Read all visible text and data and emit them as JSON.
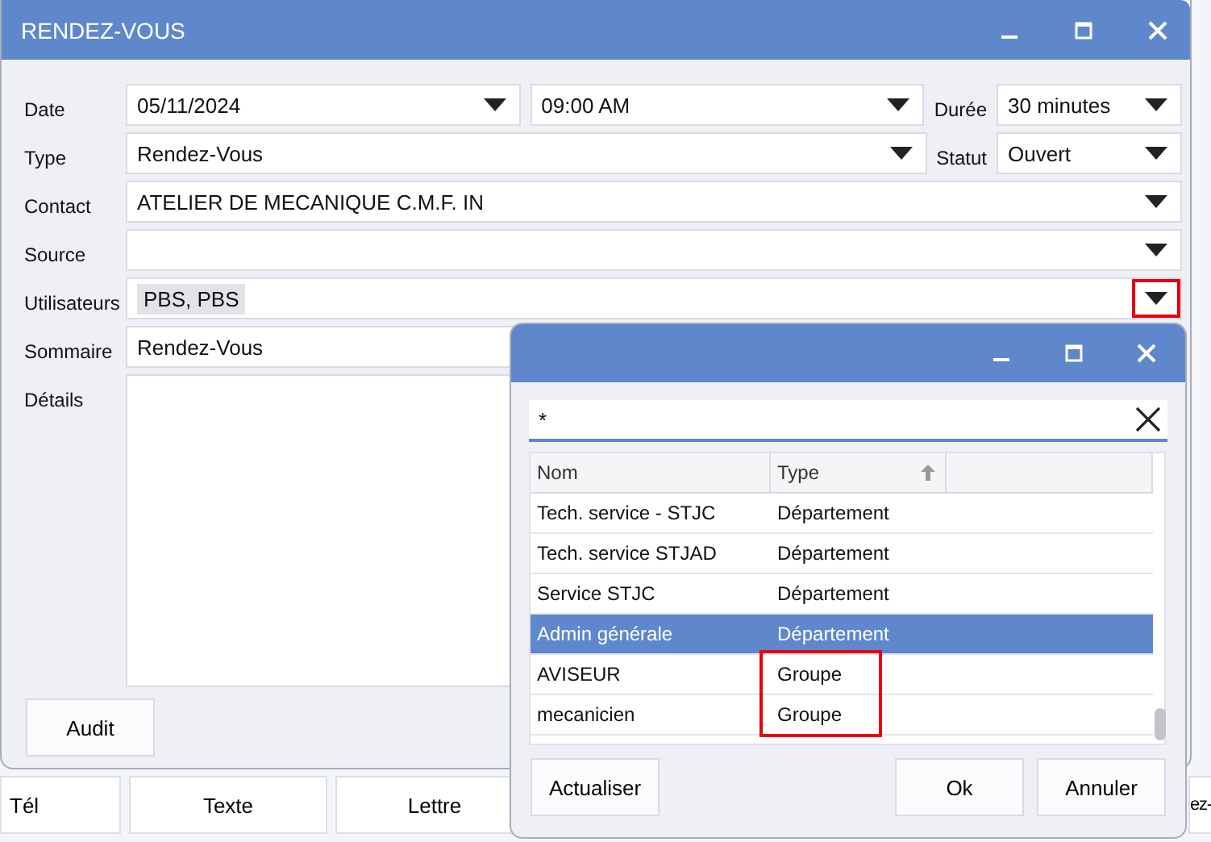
{
  "window": {
    "title": "RENDEZ-VOUS"
  },
  "form": {
    "rows": [
      {
        "fields": [
          {
            "label": "Date",
            "value": "05/11/2024",
            "kind": "dropdown",
            "highlighted": false
          },
          {
            "value": "09:00 AM",
            "kind": "dropdown",
            "highlighted": false
          },
          {
            "label": "Durée",
            "value": "30 minutes",
            "kind": "dropdown",
            "highlighted": false
          }
        ]
      },
      {
        "fields": [
          {
            "label": "Type",
            "value": "Rendez-Vous",
            "kind": "dropdown",
            "highlighted": false
          },
          {
            "label": "Statut",
            "value": "Ouvert",
            "kind": "dropdown",
            "highlighted": false
          }
        ]
      },
      {
        "fields": [
          {
            "label": "Contact",
            "value": "ATELIER DE MECANIQUE C.M.F. IN",
            "kind": "dropdown",
            "highlighted": false
          }
        ]
      },
      {
        "fields": [
          {
            "label": "Source",
            "kind": "dropdown",
            "highlighted": false
          }
        ]
      },
      {
        "fields": [
          {
            "label": "Utilisateurs",
            "value": "PBS, PBS",
            "kind": "chips",
            "highlighted": true
          }
        ]
      },
      {
        "fields": [
          {
            "label": "Sommaire",
            "value": "Rendez-Vous",
            "kind": "text"
          }
        ]
      },
      {
        "fields": [
          {
            "label": "Détails",
            "kind": "textarea"
          }
        ]
      }
    ],
    "buttons": [
      "Audit"
    ]
  },
  "bottom_bar": {
    "buttons": [
      "Tél",
      "Texte",
      "Lettre",
      "ez-"
    ]
  },
  "dialog": {
    "search": {
      "value": "*"
    },
    "table": {
      "columns": [
        {
          "label": "Nom",
          "sorted": false
        },
        {
          "label": "Type",
          "sorted": true
        }
      ],
      "rows": [
        {
          "cells": [
            "Tech. service - STJC",
            "Département"
          ],
          "selected": false,
          "highlighted": false
        },
        {
          "cells": [
            "Tech. service STJAD",
            "Département"
          ],
          "selected": false,
          "highlighted": false
        },
        {
          "cells": [
            "Service STJC",
            "Département"
          ],
          "selected": false,
          "highlighted": false
        },
        {
          "cells": [
            "Admin générale",
            "Département"
          ],
          "selected": true,
          "highlighted": false
        },
        {
          "cells": [
            "AVISEUR",
            "Groupe"
          ],
          "selected": false,
          "highlighted": true
        },
        {
          "cells": [
            "mecanicien",
            "Groupe"
          ],
          "selected": false,
          "highlighted": true
        }
      ]
    },
    "buttons": [
      "Actualiser",
      "Ok",
      "Annuler"
    ]
  }
}
